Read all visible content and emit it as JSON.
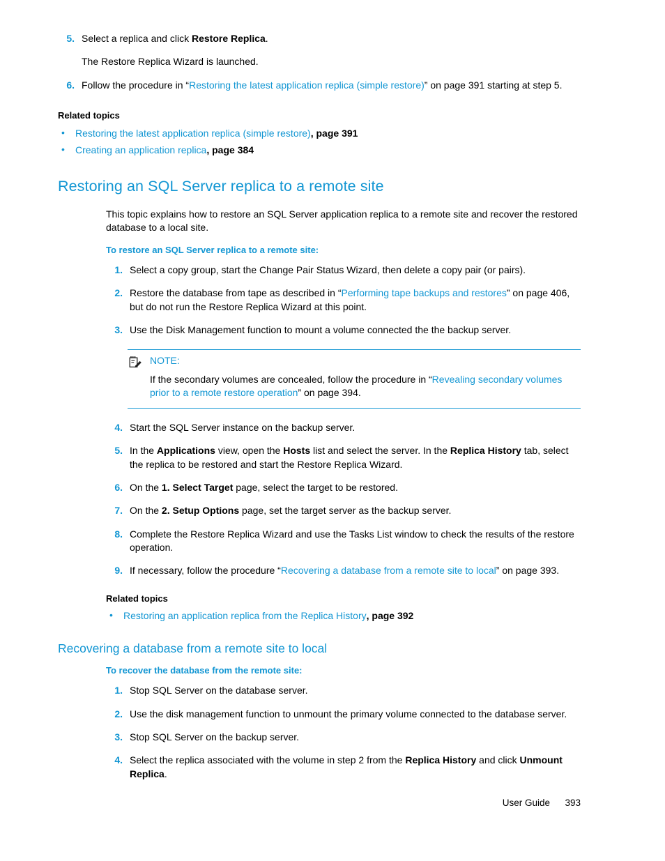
{
  "document": {
    "footer_label": "User Guide",
    "page_number": "393"
  },
  "colors": {
    "accent_blue": "#1296d3",
    "body_black": "#000000",
    "page_background": "#ffffff"
  },
  "top_section": {
    "steps": [
      {
        "num": "5.",
        "parts": [
          {
            "text": "Select a replica and click ",
            "style": "normal"
          },
          {
            "text": "Restore Replica",
            "style": "bold"
          },
          {
            "text": ".",
            "style": "normal"
          }
        ]
      }
    ],
    "step5_followup": "The Restore Replica Wizard is launched.",
    "step6": {
      "num": "6.",
      "parts": [
        {
          "text": "Follow the procedure in “",
          "style": "normal"
        },
        {
          "text": "Restoring the latest application replica (simple restore)",
          "style": "link"
        },
        {
          "text": "” on page 391 starting at step 5.",
          "style": "normal"
        }
      ]
    },
    "related_topics_heading": "Related topics",
    "related_topics": [
      {
        "link": "Restoring the latest application replica (simple restore)",
        "suffix": ", page 391"
      },
      {
        "link": "Creating an application replica",
        "suffix": ", page 384"
      }
    ]
  },
  "main_topic": {
    "title": "Restoring an SQL Server replica to a remote site",
    "intro": "This topic explains how to restore an SQL Server application replica to a remote site and recover the restored database to a local site.",
    "procedure_heading": "To restore an SQL Server replica to a remote site:",
    "steps_before_note": [
      {
        "num": "1.",
        "parts": [
          {
            "text": "Select a copy group, start the Change Pair Status Wizard, then delete a copy pair (or pairs).",
            "style": "normal"
          }
        ]
      },
      {
        "num": "2.",
        "parts": [
          {
            "text": "Restore the database from tape as described in “",
            "style": "normal"
          },
          {
            "text": "Performing tape backups and restores",
            "style": "link"
          },
          {
            "text": "” on page 406, but do not run the Restore Replica Wizard at this point.",
            "style": "normal"
          }
        ]
      },
      {
        "num": "3.",
        "parts": [
          {
            "text": "Use the Disk Management function to mount a volume connected the the backup server.",
            "style": "normal"
          }
        ]
      }
    ],
    "note": {
      "icon": "note-pencil-pad-icon",
      "label": "NOTE:",
      "parts": [
        {
          "text": "If the secondary volumes are concealed, follow the procedure in “",
          "style": "normal"
        },
        {
          "text": "Revealing secondary volumes prior to a remote restore operation",
          "style": "link"
        },
        {
          "text": "” on page 394.",
          "style": "normal"
        }
      ]
    },
    "steps_after_note": [
      {
        "num": "4.",
        "parts": [
          {
            "text": "Start the SQL Server instance on the backup server.",
            "style": "normal"
          }
        ]
      },
      {
        "num": "5.",
        "parts": [
          {
            "text": "In the ",
            "style": "normal"
          },
          {
            "text": "Applications",
            "style": "bold"
          },
          {
            "text": " view, open the ",
            "style": "normal"
          },
          {
            "text": "Hosts",
            "style": "bold"
          },
          {
            "text": " list and select the server. In the ",
            "style": "normal"
          },
          {
            "text": "Replica History",
            "style": "bold"
          },
          {
            "text": " tab, select the replica to be restored and start the Restore Replica Wizard.",
            "style": "normal"
          }
        ]
      },
      {
        "num": "6.",
        "parts": [
          {
            "text": "On the ",
            "style": "normal"
          },
          {
            "text": "1. Select Target",
            "style": "bold"
          },
          {
            "text": " page, select the target to be restored.",
            "style": "normal"
          }
        ]
      },
      {
        "num": "7.",
        "parts": [
          {
            "text": "On the ",
            "style": "normal"
          },
          {
            "text": "2. Setup Options",
            "style": "bold"
          },
          {
            "text": " page, set the target server as the backup server.",
            "style": "normal"
          }
        ]
      },
      {
        "num": "8.",
        "parts": [
          {
            "text": "Complete the Restore Replica Wizard and use the Tasks List window to check the results of the restore operation.",
            "style": "normal"
          }
        ]
      },
      {
        "num": "9.",
        "parts": [
          {
            "text": "If necessary, follow the procedure “",
            "style": "normal"
          },
          {
            "text": "Recovering a database from a remote site to local",
            "style": "link"
          },
          {
            "text": "” on page 393.",
            "style": "normal"
          }
        ]
      }
    ],
    "related_topics_heading": "Related topics",
    "related_topics": [
      {
        "link": "Restoring an application replica from the Replica History",
        "suffix": ", page 392"
      }
    ]
  },
  "sub_topic": {
    "title": "Recovering a database from a remote site to local",
    "procedure_heading": "To recover the database from the remote site:",
    "steps": [
      {
        "num": "1.",
        "parts": [
          {
            "text": "Stop SQL Server on the database server.",
            "style": "normal"
          }
        ]
      },
      {
        "num": "2.",
        "parts": [
          {
            "text": "Use the disk management function to unmount the primary volume connected to the database server.",
            "style": "normal"
          }
        ]
      },
      {
        "num": "3.",
        "parts": [
          {
            "text": "Stop SQL Server on the backup server.",
            "style": "normal"
          }
        ]
      },
      {
        "num": "4.",
        "parts": [
          {
            "text": "Select the replica associated with the volume in step 2 from the ",
            "style": "normal"
          },
          {
            "text": "Replica History",
            "style": "bold"
          },
          {
            "text": " and click ",
            "style": "normal"
          },
          {
            "text": "Unmount Replica",
            "style": "bold"
          },
          {
            "text": ".",
            "style": "normal"
          }
        ]
      }
    ]
  }
}
